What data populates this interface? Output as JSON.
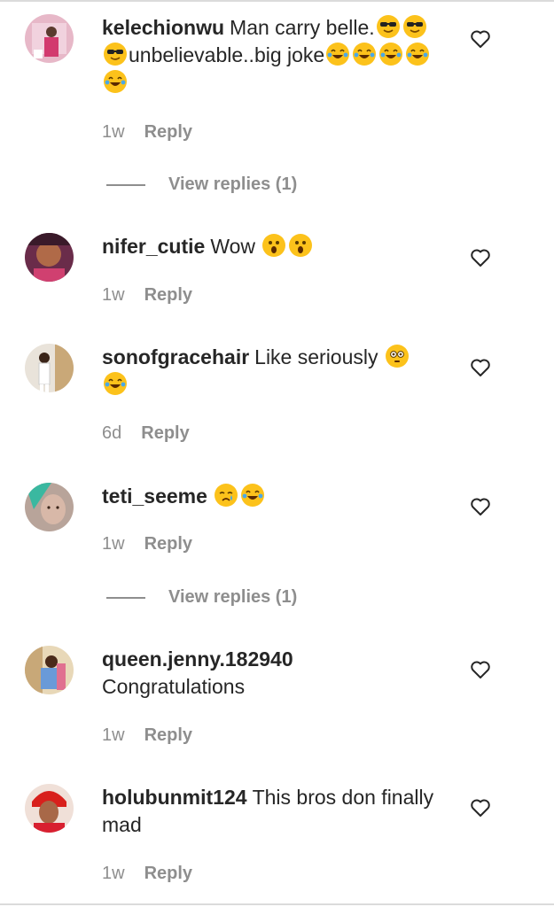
{
  "comments": [
    {
      "username": "kelechionwu",
      "text": "Man carry belle.",
      "text_emojis_1": [
        "sunglasses",
        "sunglasses",
        "sunglasses"
      ],
      "text2": "unbelievable..big joke",
      "text_emojis_2": [
        "tears-of-joy",
        "tears-of-joy",
        "tears-of-joy",
        "tears-of-joy",
        "tears-of-joy"
      ],
      "time": "1w",
      "reply": "Reply",
      "view_replies": "View replies (1)"
    },
    {
      "username": "nifer_cutie",
      "text": "Wow",
      "emojis": [
        "astonished",
        "astonished"
      ],
      "time": "1w",
      "reply": "Reply"
    },
    {
      "username": "sonofgracehair",
      "text": "Like seriously",
      "emojis": [
        "flushed",
        "tears-of-joy"
      ],
      "time": "6d",
      "reply": "Reply"
    },
    {
      "username": "teti_seeme",
      "text": "",
      "emojis": [
        "crying",
        "tears-of-joy"
      ],
      "time": "1w",
      "reply": "Reply",
      "view_replies": "View replies (1)"
    },
    {
      "username": "queen.jenny.182940",
      "text": "Congratulations",
      "time": "1w",
      "reply": "Reply"
    },
    {
      "username": "holubunmit124",
      "text": "This bros don finally mad",
      "time": "1w",
      "reply": "Reply"
    }
  ],
  "colors": {
    "text": "#262626",
    "muted": "#8e8e8e",
    "divider": "#dbdbdb",
    "emoji_yellow": "#fcc21b"
  },
  "icons": {
    "like": "heart-outline-icon"
  }
}
